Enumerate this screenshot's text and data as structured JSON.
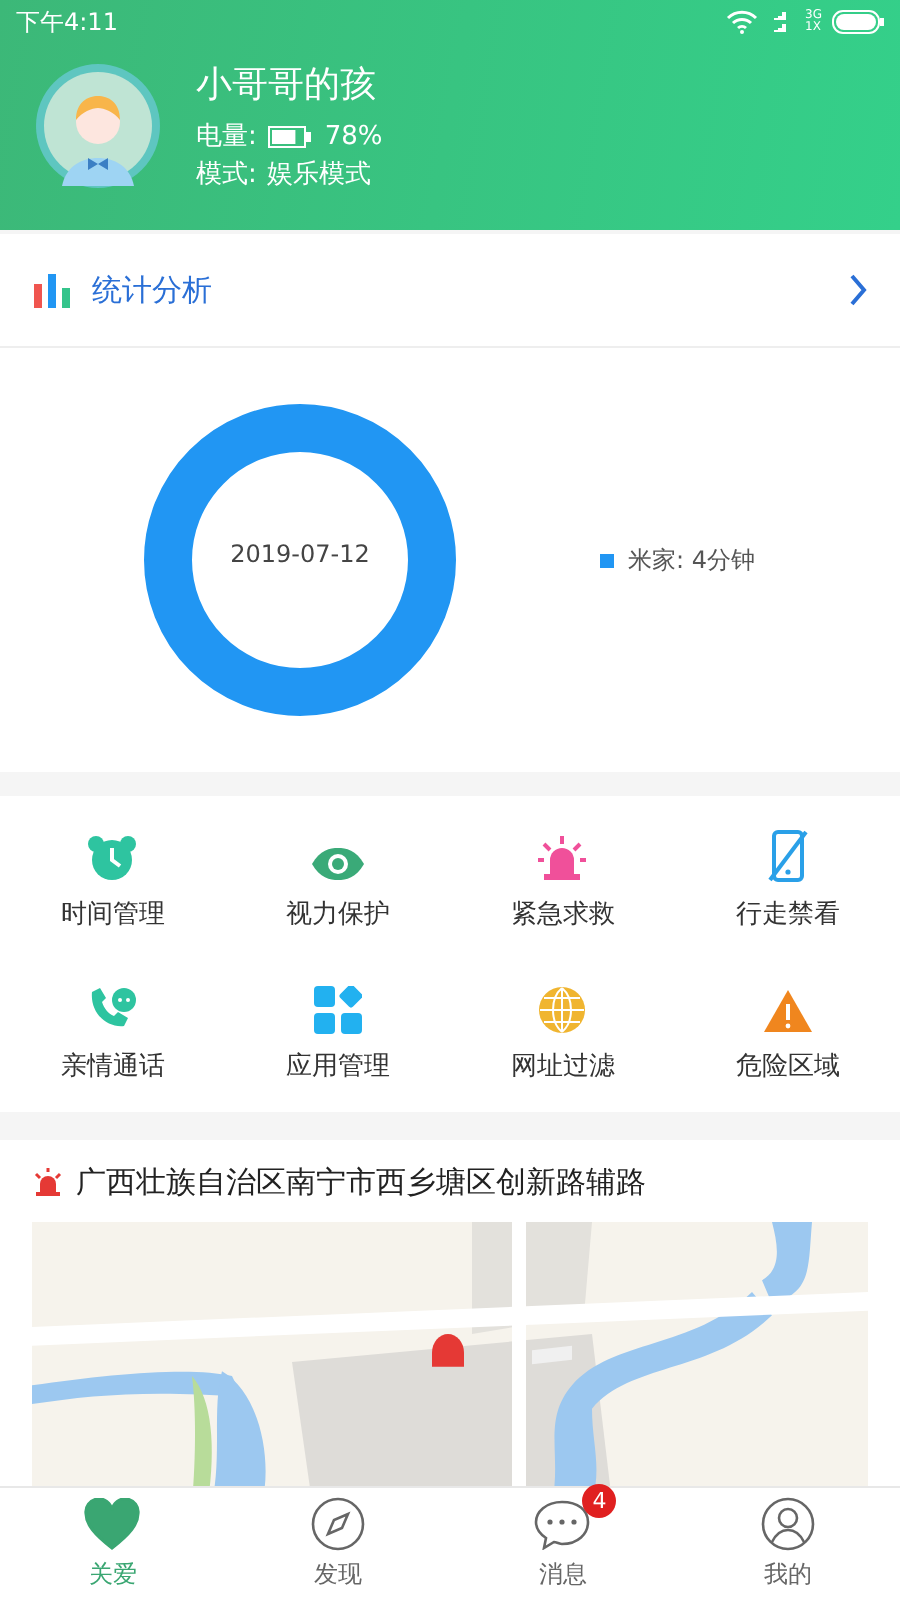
{
  "status_bar": {
    "time": "下午4:11",
    "network_top": "3G",
    "network_bottom": "1X"
  },
  "profile": {
    "name": "小哥哥的孩",
    "battery_label": "电量:",
    "battery": {
      "level": 0.78
    },
    "battery_text": "78%",
    "mode_label": "模式:",
    "mode": "娱乐模式"
  },
  "stats": {
    "title": "统计分析",
    "center_date": "2019-07-12",
    "legend": [
      {
        "label": "米家: 4分钟",
        "color": "#2196f3"
      }
    ]
  },
  "features": [
    {
      "label": "时间管理",
      "kind": "alarm"
    },
    {
      "label": "视力保护",
      "kind": "eye"
    },
    {
      "label": "紧急求救",
      "kind": "siren"
    },
    {
      "label": "行走禁看",
      "kind": "phone-off"
    },
    {
      "label": "亲情通话",
      "kind": "call"
    },
    {
      "label": "应用管理",
      "kind": "apps"
    },
    {
      "label": "网址过滤",
      "kind": "globe"
    },
    {
      "label": "危险区域",
      "kind": "warning"
    }
  ],
  "location": {
    "address": "广西壮族自治区南宁市西乡塘区创新路辅路"
  },
  "tab_bar": [
    {
      "label": "关爱",
      "kind": "heart",
      "selected": true
    },
    {
      "label": "发现",
      "kind": "compass",
      "selected": false
    },
    {
      "label": "消息",
      "kind": "chat",
      "selected": false,
      "badge": "4"
    },
    {
      "label": "我的",
      "kind": "user",
      "selected": false
    }
  ]
}
